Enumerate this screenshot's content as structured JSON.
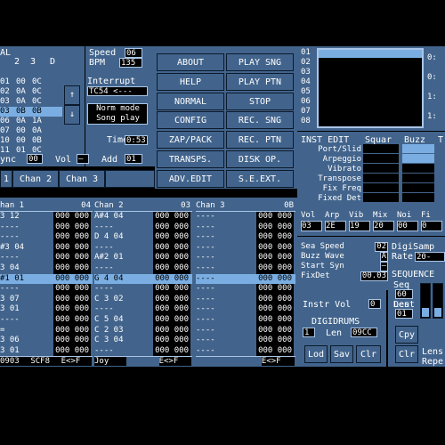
{
  "left_panel": {
    "header_fragment": "AL",
    "col_headers": [
      "2",
      "3",
      "D"
    ],
    "rows": [
      {
        "a": "",
        "b": "",
        "c": "",
        "d": ""
      },
      {
        "a": "01",
        "b": "00",
        "c": "0C",
        "d": ""
      },
      {
        "a": "02",
        "b": "0A",
        "c": "0C",
        "d": ""
      },
      {
        "a": "03",
        "b": "0A",
        "c": "0C",
        "d": ""
      },
      {
        "a": "03",
        "b": "0B",
        "c": "0B",
        "d": ""
      },
      {
        "a": "06",
        "b": "0A",
        "c": "1A",
        "d": ""
      },
      {
        "a": "07",
        "b": "00",
        "c": "0A",
        "d": ""
      },
      {
        "a": "10",
        "b": "00",
        "c": "0B",
        "d": ""
      },
      {
        "a": "11",
        "b": "01",
        "c": "0C",
        "d": ""
      }
    ],
    "up_arrow": "↑",
    "down_arrow": "↓",
    "sync_label": "ync",
    "sync_value": "00",
    "vol_label": "Vol",
    "vol_value": "—",
    "add_label": "Add",
    "add_value": "01"
  },
  "speed": {
    "speed_label": "Speed",
    "speed_value": "06",
    "bpm_label": "BPM",
    "bpm_value": "135"
  },
  "interrupt": {
    "label": "Interrupt",
    "value": "TC54 <---"
  },
  "mode_box": {
    "line1": "Norm mode",
    "line2": "Song play"
  },
  "time": {
    "label": "Time",
    "value": "0:53"
  },
  "menu_buttons": [
    [
      "ABOUT",
      "PLAY SNG"
    ],
    [
      "HELP",
      "PLAY PTN"
    ],
    [
      "NORMAL",
      "STOP"
    ],
    [
      "CONFIG",
      "REC. SNG"
    ],
    [
      "ZAP/PACK",
      "REC. PTN"
    ],
    [
      "TRANSPS.",
      "DISK OP."
    ],
    [
      "ADV.EDIT",
      "S.E.EXT."
    ]
  ],
  "chan_tabs": [
    "1",
    "Chan 2",
    "Chan 3"
  ],
  "pattern_list": [
    "01",
    "02",
    "03",
    "04",
    "05",
    "06",
    "07",
    "08"
  ],
  "right_edge_numbers": [
    "0:",
    "0:",
    "1:",
    "1:"
  ],
  "inst_edit": {
    "title": "INST EDIT",
    "labels": [
      "Port/Slid",
      "Arpeggio",
      "Vibrato",
      "Transpose",
      "Fix Freq",
      "Fixed Det"
    ],
    "squar_label": "Squar",
    "buzz_label": "Buzz",
    "t_label": "T"
  },
  "param_headers": [
    "Vol",
    "Arp",
    "Vib",
    "Mix",
    "Noi",
    "Fi"
  ],
  "param_values": [
    "03",
    "2E",
    "19",
    "20",
    "00",
    "0"
  ],
  "snd_params": {
    "labels": [
      "Sea Speed",
      "Buzz Wave",
      "Start Syn",
      "FixDet"
    ],
    "values": [
      "02",
      "A",
      "—",
      "00.03"
    ]
  },
  "digisamp": {
    "label": "DigiSamp",
    "rate_label": "Rate",
    "rate_value": "20-"
  },
  "instr_vol": {
    "label": "Instr Vol",
    "value": "0"
  },
  "digidrums": {
    "title": "DIGIDRUMS",
    "num": "1",
    "len_label": "Len",
    "len_value": "09CC"
  },
  "bottom_buttons": [
    "Lod",
    "Sav",
    "Clr"
  ],
  "sequence": {
    "title": "SEQUENCE",
    "seq_label": "Seq",
    "seq_value": "60",
    "len_label": "Len",
    "len_value": "01",
    "dest_label": "Dest",
    "dest_value": "01",
    "cpy": "Cpy",
    "clr": "Clr",
    "lens_label": "Lens",
    "repe_label": "Repe"
  },
  "channels": [
    {
      "name": "han 1",
      "num": "04",
      "rows": [
        {
          "note": "3 12",
          "v": "000 000"
        },
        {
          "note": "----",
          "v": "000 000"
        },
        {
          "note": "----",
          "v": "000 000"
        },
        {
          "note": "#3 04",
          "v": "000 000"
        },
        {
          "note": "----",
          "v": "000 000"
        },
        {
          "note": "3 04",
          "v": "000 000"
        },
        {
          "note": "#1 01",
          "v": "000 000"
        },
        {
          "note": "----",
          "v": "000 000"
        },
        {
          "note": "3 07",
          "v": "000 000"
        },
        {
          "note": "3 01",
          "v": "000 000"
        },
        {
          "note": "----",
          "v": "000 000"
        },
        {
          "note": "=",
          "v": "000 000"
        },
        {
          "note": "3 06",
          "v": "000 000"
        },
        {
          "note": "3 01",
          "v": "000 000"
        }
      ],
      "footer": [
        "0903",
        "SCF8",
        "E<>F"
      ]
    },
    {
      "name": "Chan 2",
      "num": "03",
      "rows": [
        {
          "note": "A#4 04",
          "v": "000 000"
        },
        {
          "note": "----",
          "v": "000 000"
        },
        {
          "note": "D 4 04",
          "v": "000 000"
        },
        {
          "note": "----",
          "v": "000 000"
        },
        {
          "note": "A#2 01",
          "v": "000 000"
        },
        {
          "note": "----",
          "v": "000 000"
        },
        {
          "note": "G 4 04",
          "v": "000 000"
        },
        {
          "note": "----",
          "v": "000 000"
        },
        {
          "note": "C 3 02",
          "v": "000 000"
        },
        {
          "note": "----",
          "v": "000 000"
        },
        {
          "note": "C 5 04",
          "v": "000 000"
        },
        {
          "note": "C 2 03",
          "v": "000 000"
        },
        {
          "note": "C 3 04",
          "v": "000 000"
        },
        {
          "note": "----",
          "v": "000 000"
        }
      ],
      "footer": [
        "Joy",
        "",
        "E<>F"
      ]
    },
    {
      "name": "Chan 3",
      "num": "0B",
      "rows": [
        {
          "note": "----",
          "v": "000 000"
        },
        {
          "note": "----",
          "v": "000 000"
        },
        {
          "note": "----",
          "v": "000 000"
        },
        {
          "note": "----",
          "v": "000 000"
        },
        {
          "note": "----",
          "v": "000 000"
        },
        {
          "note": "----",
          "v": "000 000"
        },
        {
          "note": "----",
          "v": "000 000"
        },
        {
          "note": "----",
          "v": "000 000"
        },
        {
          "note": "----",
          "v": "000 000"
        },
        {
          "note": "----",
          "v": "000 000"
        },
        {
          "note": "----",
          "v": "000 000"
        },
        {
          "note": "----",
          "v": "000 000"
        },
        {
          "note": "----",
          "v": "000 000"
        },
        {
          "note": "----",
          "v": "000 000"
        }
      ],
      "footer": [
        "",
        "",
        "E<>F"
      ]
    }
  ],
  "selected_row_index": 6,
  "colors": {
    "panel": "#42648c",
    "highlight": "#7aaee2",
    "dark": "#000000"
  }
}
